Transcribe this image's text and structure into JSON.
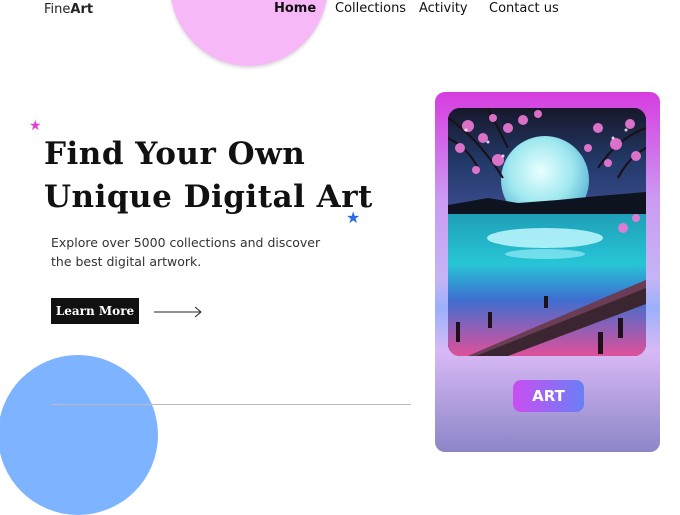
{
  "brand": {
    "name_light": "Fine",
    "name_bold": "Art"
  },
  "nav": {
    "home": "Home",
    "collections": "Collections",
    "activity": "Activity",
    "contact": "Contact us"
  },
  "hero": {
    "title_line1": "Find Your Own",
    "title_line2": "Unique Digital Art",
    "description_line1": "Explore over 5000 collections and discover",
    "description_line2": "the best digital artwork.",
    "cta_label": "Learn More"
  },
  "card": {
    "button_label": "ART"
  },
  "icons": {
    "cta_arrow": "right-arrow-icon",
    "star_left": "star-icon",
    "star_right": "star-icon"
  },
  "colors": {
    "pink_blob": "#f6b8f7",
    "blue_blob": "#7eb4ff",
    "star_pink": "#e33fd4",
    "star_blue": "#2b6de8",
    "button_dark": "#111111",
    "card_gradient_top": "#d63ce0",
    "card_gradient_bottom": "#8c86c8"
  }
}
